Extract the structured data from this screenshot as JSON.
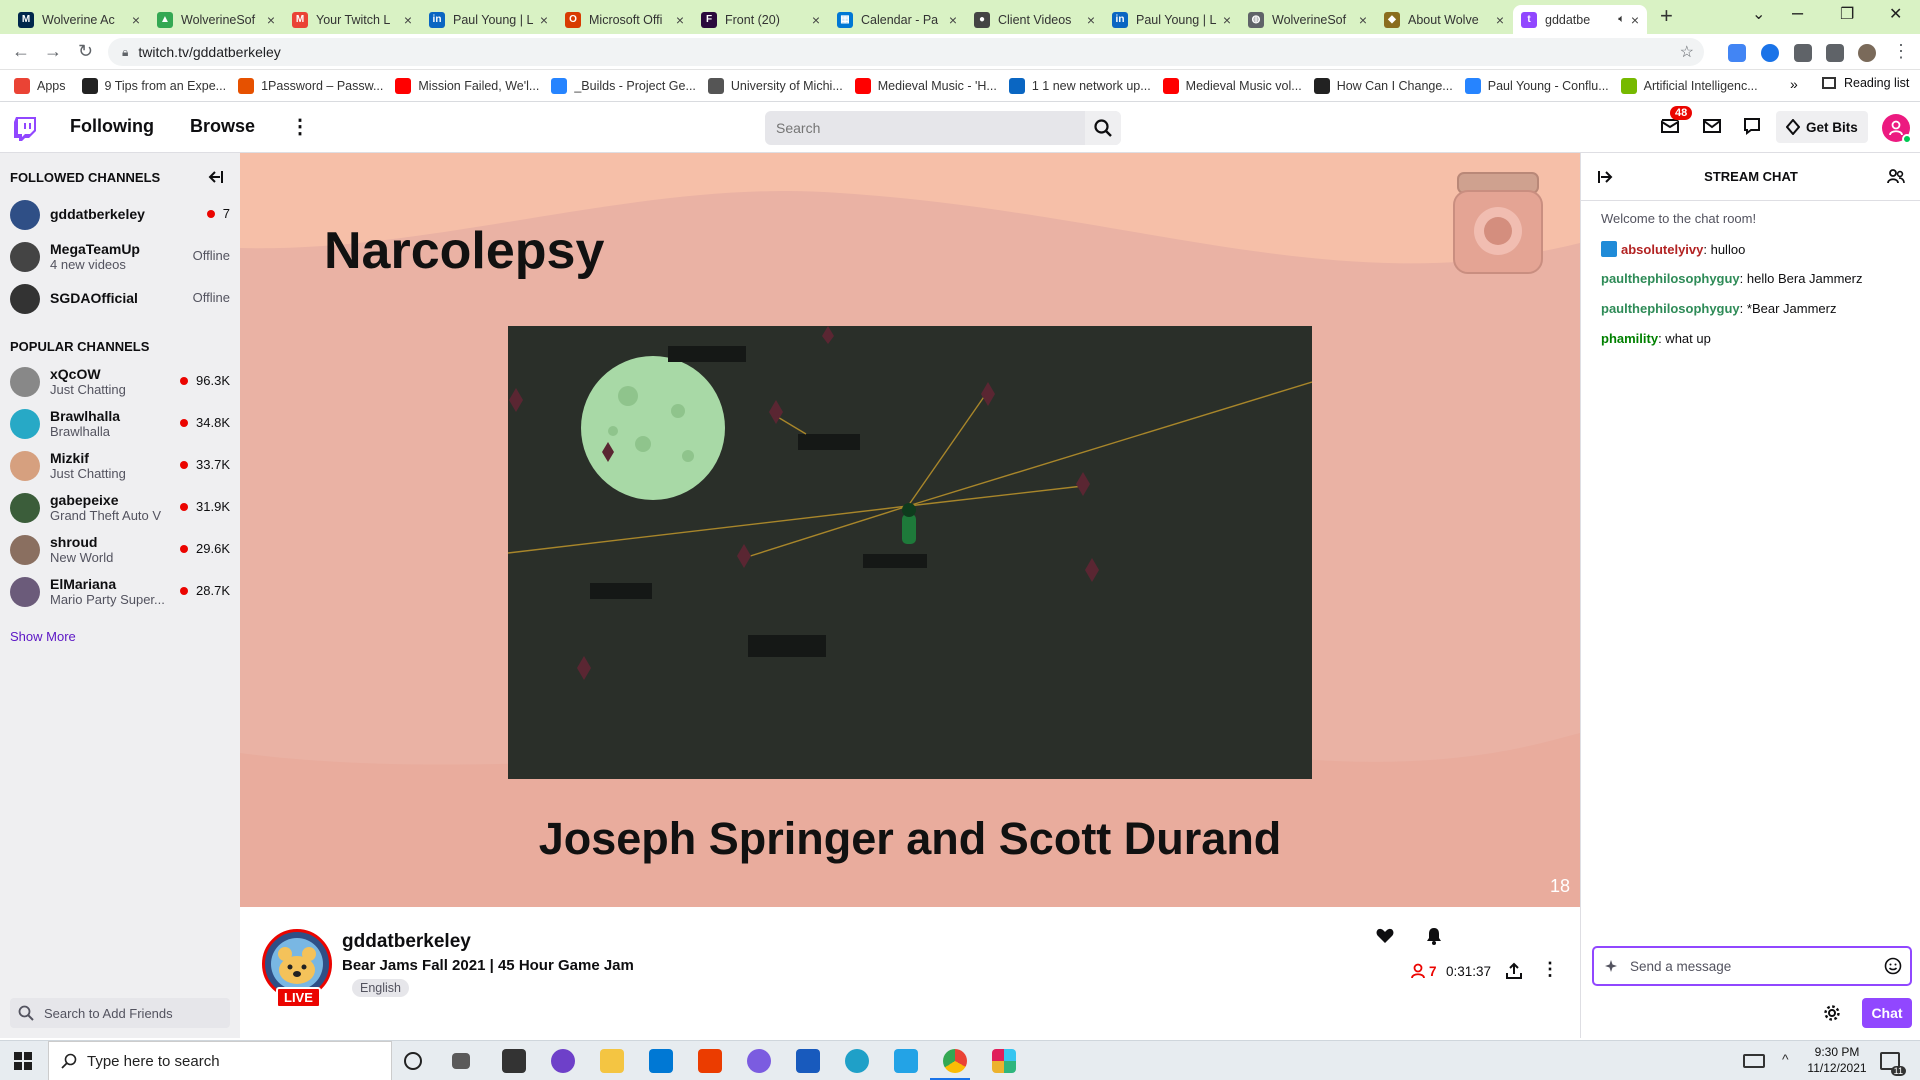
{
  "browser": {
    "tabs": [
      {
        "title": "Wolverine Ac",
        "color": "#00274c",
        "glyph": "M"
      },
      {
        "title": "WolverineSof",
        "color": "#34a853",
        "glyph": "▲"
      },
      {
        "title": "Your Twitch L",
        "color": "#ea4335",
        "glyph": "M"
      },
      {
        "title": "Paul Young | L",
        "color": "#0a66c2",
        "glyph": "in"
      },
      {
        "title": "Microsoft Offi",
        "color": "#d83b01",
        "glyph": "O"
      },
      {
        "title": "Front (20)",
        "color": "#2b0a3d",
        "glyph": "F"
      },
      {
        "title": "Calendar - Pa",
        "color": "#0078d4",
        "glyph": "▦"
      },
      {
        "title": "Client Videos",
        "color": "#444444",
        "glyph": "●"
      },
      {
        "title": "Paul Young | L",
        "color": "#0a66c2",
        "glyph": "in"
      },
      {
        "title": "WolverineSof",
        "color": "#5f6368",
        "glyph": "◍"
      },
      {
        "title": "About Wolve",
        "color": "#8a6d1e",
        "glyph": "◆"
      },
      {
        "title": "gddatbe",
        "color": "#9147ff",
        "glyph": "t",
        "active": true
      }
    ],
    "new_tab_label": "+",
    "url": "twitch.tv/gddatberkeley",
    "bookmarks": [
      {
        "label": "Apps",
        "color": "#ea4335"
      },
      {
        "label": "9 Tips from an Expe...",
        "color": "#222222"
      },
      {
        "label": "1Password – Passw...",
        "color": "#e65100"
      },
      {
        "label": "Mission Failed, We'l...",
        "color": "#ff0000"
      },
      {
        "label": "_Builds - Project Ge...",
        "color": "#2684ff"
      },
      {
        "label": "University of Michi...",
        "color": "#555555"
      },
      {
        "label": "Medieval Music - 'H...",
        "color": "#ff0000"
      },
      {
        "label": "1 1 new network up...",
        "color": "#0a66c2"
      },
      {
        "label": "Medieval Music vol...",
        "color": "#ff0000"
      },
      {
        "label": "How Can I Change...",
        "color": "#222222"
      },
      {
        "label": "Paul Young - Conflu...",
        "color": "#2684ff"
      },
      {
        "label": "Artificial Intelligenc...",
        "color": "#76b900"
      }
    ],
    "bookmarks_more": "»",
    "reading_list": "Reading list"
  },
  "twitch": {
    "nav": {
      "following": "Following",
      "browse": "Browse",
      "more": "⋮"
    },
    "search_placeholder": "Search",
    "notifications_count": "48",
    "get_bits": "Get Bits",
    "sidebar": {
      "followed_header": "FOLLOWED CHANNELS",
      "followed": [
        {
          "name": "gddatberkeley",
          "sub": "",
          "status": "7",
          "live": true,
          "color": "#2f4f86"
        },
        {
          "name": "MegaTeamUp",
          "sub": "4 new videos",
          "status": "Offline",
          "live": false,
          "color": "#444444"
        },
        {
          "name": "SGDAOfficial",
          "sub": "",
          "status": "Offline",
          "live": false,
          "color": "#333333"
        }
      ],
      "popular_header": "POPULAR CHANNELS",
      "popular": [
        {
          "name": "xQcOW",
          "sub": "Just Chatting",
          "status": "96.3K",
          "live": true,
          "color": "#888888"
        },
        {
          "name": "Brawlhalla",
          "sub": "Brawlhalla",
          "status": "34.8K",
          "live": true,
          "color": "#27a9c6"
        },
        {
          "name": "Mizkif",
          "sub": "Just Chatting",
          "status": "33.7K",
          "live": true,
          "color": "#d6a07f"
        },
        {
          "name": "gabepeixe",
          "sub": "Grand Theft Auto V",
          "status": "31.9K",
          "live": true,
          "color": "#3b5d3a"
        },
        {
          "name": "shroud",
          "sub": "New World",
          "status": "29.6K",
          "live": true,
          "color": "#8a6f60"
        },
        {
          "name": "ElMariana",
          "sub": "Mario Party Super...",
          "status": "28.7K",
          "live": true,
          "color": "#6b5b7a"
        }
      ],
      "show_more": "Show More",
      "friends_placeholder": "Search to Add Friends"
    },
    "video": {
      "game_title": "Narcolepsy",
      "authors": "Joseph Springer and Scott Durand",
      "slide_number": "18"
    },
    "stream_info": {
      "streamer": "gddatberkeley",
      "title": "Bear Jams Fall 2021 | 45 Hour Game Jam",
      "language": "English",
      "live_label": "LIVE",
      "viewers": "7",
      "uptime": "0:31:37"
    },
    "chat": {
      "header": "STREAM CHAT",
      "welcome": "Welcome to the chat room!",
      "messages": [
        {
          "user": "absolutelyivy",
          "text": ": hulloo",
          "color": "#b22222"
        },
        {
          "user": "paulthephilosophyguy",
          "text": ": hello Bera Jammerz",
          "color": "#2e8b57"
        },
        {
          "user": "paulthephilosophyguy",
          "text": ": *Bear Jammerz",
          "color": "#2e8b57"
        },
        {
          "user": "phamility",
          "text": ": what up",
          "color": "#008000"
        }
      ],
      "input_placeholder": "Send a message",
      "chat_button": "Chat"
    }
  },
  "taskbar": {
    "search_placeholder": "Type here to search",
    "time": "9:30 PM",
    "date": "11/12/2021",
    "notification_count": "11"
  }
}
